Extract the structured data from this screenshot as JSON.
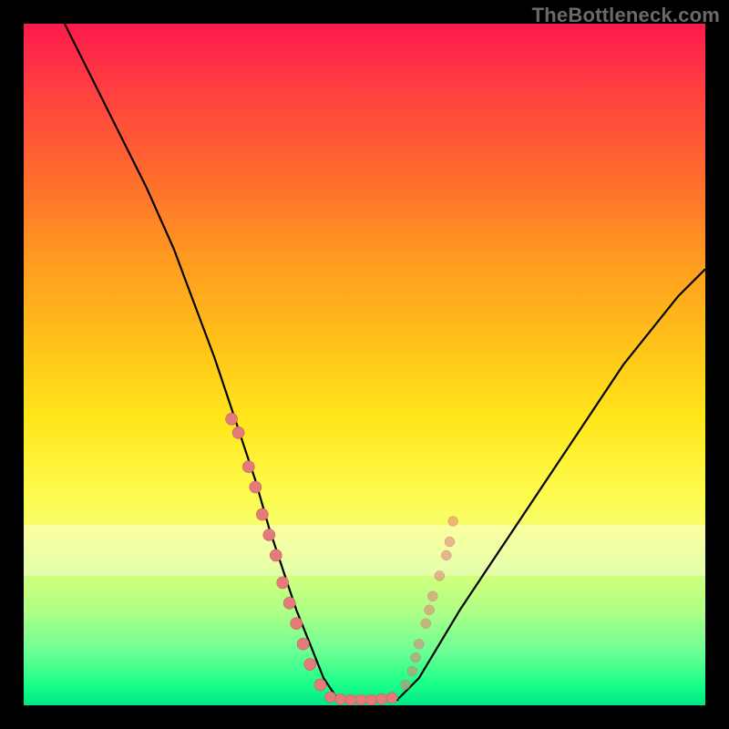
{
  "watermark": "TheBottleneck.com",
  "colors": {
    "dot": "#e47a7a",
    "dot_stroke": "#c96065",
    "curve": "#000000"
  },
  "chart_data": {
    "type": "line",
    "title": "",
    "xlabel": "",
    "ylabel": "",
    "xlim": [
      0,
      100
    ],
    "ylim": [
      0,
      100
    ],
    "grid": false,
    "series": [
      {
        "name": "left_curve",
        "x": [
          6,
          10,
          14,
          18,
          22,
          25,
          28,
          31,
          34,
          36,
          38,
          40,
          42,
          44,
          46
        ],
        "y": [
          100,
          92,
          84,
          76,
          67,
          59,
          51,
          42,
          33,
          26,
          20,
          14,
          9,
          4,
          1
        ]
      },
      {
        "name": "right_curve",
        "x": [
          55,
          58,
          61,
          64,
          68,
          72,
          76,
          80,
          84,
          88,
          92,
          96,
          100
        ],
        "y": [
          1,
          4,
          9,
          14,
          20,
          26,
          32,
          38,
          44,
          50,
          55,
          60,
          64
        ]
      }
    ],
    "valley_flat": {
      "x_start": 46,
      "x_end": 55,
      "y": 0.8
    },
    "markers_left": [
      {
        "x": 30.5,
        "y": 42
      },
      {
        "x": 31.5,
        "y": 40
      },
      {
        "x": 33.0,
        "y": 35
      },
      {
        "x": 34.0,
        "y": 32
      },
      {
        "x": 35.0,
        "y": 28
      },
      {
        "x": 36.0,
        "y": 25
      },
      {
        "x": 37.0,
        "y": 22
      },
      {
        "x": 38.0,
        "y": 18
      },
      {
        "x": 39.0,
        "y": 15
      },
      {
        "x": 40.0,
        "y": 12
      },
      {
        "x": 41.0,
        "y": 9
      },
      {
        "x": 42.0,
        "y": 6
      },
      {
        "x": 43.5,
        "y": 3
      }
    ],
    "markers_right": [
      {
        "x": 56.0,
        "y": 3
      },
      {
        "x": 57.0,
        "y": 5
      },
      {
        "x": 57.5,
        "y": 7
      },
      {
        "x": 58.0,
        "y": 9
      },
      {
        "x": 59.0,
        "y": 12
      },
      {
        "x": 59.5,
        "y": 14
      },
      {
        "x": 60.0,
        "y": 16
      },
      {
        "x": 61.0,
        "y": 19
      },
      {
        "x": 62.0,
        "y": 22
      },
      {
        "x": 62.5,
        "y": 24
      },
      {
        "x": 63.0,
        "y": 27
      }
    ],
    "markers_bottom": [
      {
        "x": 45,
        "y": 1.2
      },
      {
        "x": 46.5,
        "y": 0.9
      },
      {
        "x": 48,
        "y": 0.8
      },
      {
        "x": 49.5,
        "y": 0.8
      },
      {
        "x": 51,
        "y": 0.8
      },
      {
        "x": 52.5,
        "y": 0.9
      },
      {
        "x": 54,
        "y": 1.1
      }
    ]
  }
}
